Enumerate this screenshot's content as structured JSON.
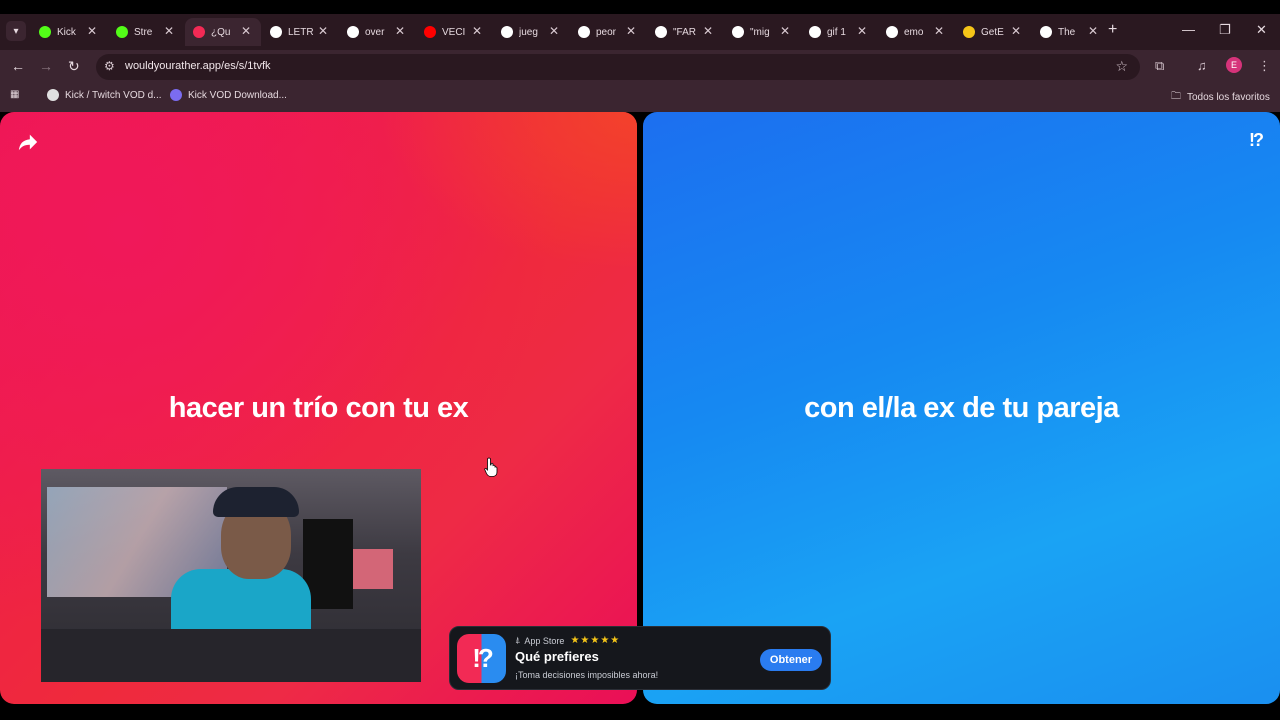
{
  "browser": {
    "tabs": [
      {
        "title": "Kick",
        "favicon_color": "#53fc18"
      },
      {
        "title": "Stre",
        "favicon_color": "#53fc18"
      },
      {
        "title": "¿Qu",
        "favicon_color": "#f22a55",
        "active": true
      },
      {
        "title": "LETR",
        "favicon_color": "#ffffff"
      },
      {
        "title": "over",
        "favicon_color": "#ffffff"
      },
      {
        "title": "VECI",
        "favicon_color": "#ff0000"
      },
      {
        "title": "jueg",
        "favicon_color": "#ffffff"
      },
      {
        "title": "peor",
        "favicon_color": "#ffffff"
      },
      {
        "title": "\"FAR",
        "favicon_color": "#ffffff"
      },
      {
        "title": "\"mig",
        "favicon_color": "#ffffff"
      },
      {
        "title": "gif 1",
        "favicon_color": "#ffffff"
      },
      {
        "title": "emo",
        "favicon_color": "#ffffff"
      },
      {
        "title": "GetE",
        "favicon_color": "#f5c518"
      },
      {
        "title": "The",
        "favicon_color": "#ffffff"
      }
    ],
    "url": "wouldyourather.app/es/s/1tvfk",
    "profile_initial": "E",
    "bookmarks": [
      {
        "label": "Kick / Twitch VOD d...",
        "icon_color": "#e0e0e0"
      },
      {
        "label": "Kick VOD Download...",
        "icon_color": "#7b6cf0"
      }
    ],
    "all_bookmarks_label": "Todos los favoritos"
  },
  "page": {
    "option_a": "hacer un trío con tu ex",
    "option_b": "con el/la ex de tu pareja",
    "logo_text": "!?",
    "colors": {
      "option_a": "#ee1552",
      "option_b": "#1a8ff0"
    }
  },
  "app_banner": {
    "store_label": "App Store",
    "stars": "★★★★★",
    "app_name": "Qué prefieres",
    "tagline": "¡Toma decisiones imposibles ahora!",
    "cta": "Obtener",
    "icon_text": "!?"
  }
}
